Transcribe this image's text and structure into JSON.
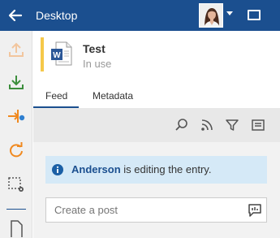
{
  "header": {
    "title": "Desktop"
  },
  "document": {
    "title": "Test",
    "status": "In use",
    "app_letter": "W"
  },
  "tabs": [
    {
      "label": "Feed",
      "active": true
    },
    {
      "label": "Metadata",
      "active": false
    }
  ],
  "feed": {
    "info": {
      "user": "Anderson",
      "message": " is editing the entry."
    },
    "post_placeholder": "Create a post"
  },
  "colors": {
    "header_bg": "#1b4f8f",
    "accent": "#f5c84a",
    "upload_icon": "#f2c69e",
    "download_icon": "#3c8e3c",
    "orange_icon": "#f0891f",
    "info_bg": "#d5e9f7"
  },
  "icons": {
    "back": "arrow-left-icon",
    "caret": "chevron-down-icon",
    "window": "window-icon",
    "sidebar": [
      "upload-icon",
      "download-icon",
      "checkout-icon",
      "refresh-icon",
      "selection-settings-icon",
      "document-icon"
    ],
    "toolbar": [
      "search-icon",
      "rss-icon",
      "filter-icon",
      "list-icon"
    ],
    "info": "info-icon",
    "post": "comment-icon"
  }
}
